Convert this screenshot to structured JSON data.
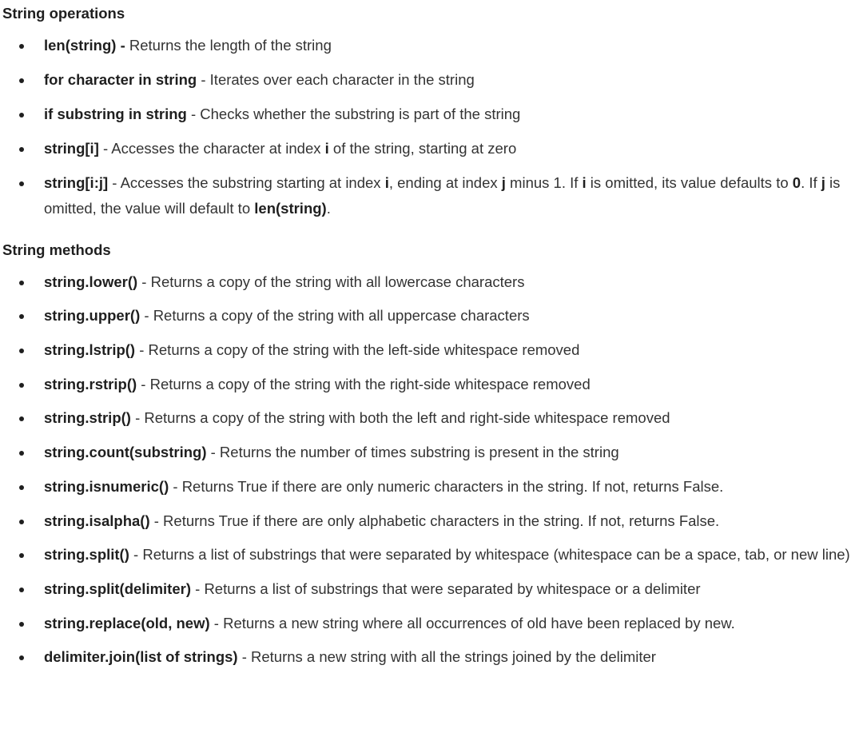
{
  "operations": {
    "title": "String operations",
    "items": [
      {
        "term": "len(string) -",
        "parts": [
          " Returns the length of the string"
        ]
      },
      {
        "term": "for character in string",
        "parts": [
          " - Iterates over each character in the string"
        ]
      },
      {
        "term": "if substring in string",
        "parts": [
          " - Checks whether the substring is part of the string"
        ]
      },
      {
        "term": "string[i]",
        "parts": [
          " - Accesses the character at index ",
          "i",
          " of the string, starting at zero"
        ]
      },
      {
        "term": "string[i:j]",
        "parts": [
          " - Accesses the substring starting at index ",
          "i",
          ", ending at index ",
          "j",
          " minus 1. If ",
          "i",
          " is omitted, its value defaults to ",
          "0",
          ". If ",
          "j",
          " is omitted, the value will default to ",
          "len(string)",
          "."
        ]
      }
    ]
  },
  "methods": {
    "title": "String methods",
    "items": [
      {
        "term": "string.lower()",
        "desc": " - Returns a copy of the string with all lowercase characters"
      },
      {
        "term": "string.upper()",
        "desc": " - Returns a copy of the string with all uppercase characters"
      },
      {
        "term": "string.lstrip()",
        "desc": " - Returns a copy of the string with the left-side whitespace removed"
      },
      {
        "term": "string.rstrip()",
        "desc": " - Returns a copy of the string with the right-side whitespace removed"
      },
      {
        "term": "string.strip()",
        "desc": " - Returns a copy of the string with both the left and right-side whitespace removed"
      },
      {
        "term": "string.count(substring)",
        "desc": " - Returns the number of times substring is present in the string"
      },
      {
        "term": "string.isnumeric()",
        "desc": " - Returns True if there are only numeric characters in the string. If not, returns False."
      },
      {
        "term": "string.isalpha()",
        "desc": " - Returns True if there are only alphabetic characters in the string. If not, returns False."
      },
      {
        "term": "string.split()",
        "desc": " - Returns a list of substrings that were separated by whitespace (whitespace can be a space, tab, or new line)"
      },
      {
        "term": "string.split(delimiter)",
        "desc": " - Returns a list of substrings that were separated by whitespace or a delimiter"
      },
      {
        "term": "string.replace(old, new)",
        "desc": " - Returns a new string where all occurrences of old have been replaced by new."
      },
      {
        "term": "delimiter.join(list of strings)",
        "desc": " - Returns a new string with all the strings joined by the delimiter"
      }
    ]
  }
}
